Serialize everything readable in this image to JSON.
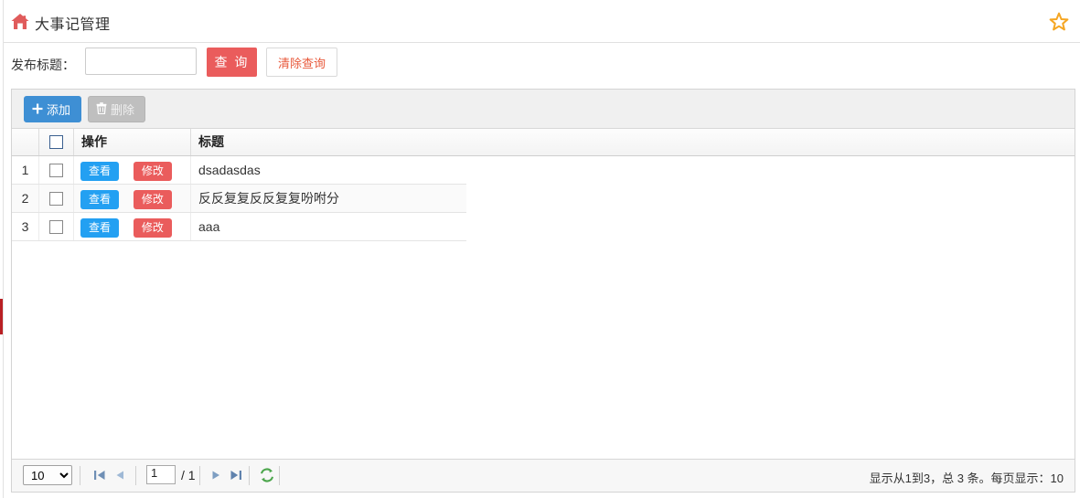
{
  "header": {
    "home_icon": "home-icon",
    "title": "大事记管理",
    "star_icon": "star-favorite-icon"
  },
  "search": {
    "label": "发布标题：",
    "input_value": "",
    "input_placeholder": "",
    "query_button": "查 询",
    "clear_button": "清除查询"
  },
  "toolbar": {
    "add_label": "添加",
    "add_icon": "plus-icon",
    "delete_label": "删除",
    "delete_icon": "trash-icon"
  },
  "grid": {
    "columns": [
      "",
      "",
      "操作",
      "标题"
    ],
    "header_checkbox": "select-all-checkbox",
    "row_actions": {
      "view": "查看",
      "edit": "修改"
    },
    "rows": [
      {
        "index": "1",
        "title": "dsadasdas"
      },
      {
        "index": "2",
        "title": "反反复复反反复复吩咐分"
      },
      {
        "index": "3",
        "title": "aaa"
      }
    ]
  },
  "pager": {
    "page_size": "10",
    "page_size_options": [
      "10"
    ],
    "first_icon": "first-page-icon",
    "prev_icon": "prev-page-icon",
    "page_number": "1",
    "page_total": "/ 1",
    "next_icon": "next-page-icon",
    "last_icon": "last-page-icon",
    "refresh_icon": "refresh-icon",
    "info": "显示从1到3，总 3 条。每页显示：10"
  },
  "colors": {
    "primary_blue": "#3e8fd4",
    "action_blue": "#23a0f2",
    "accent_red": "#ea5c5c",
    "clear_text": "#e8593b",
    "star_gold": "#f5a623",
    "sidebar_active": "#b92024",
    "refresh_green": "#4ca64c"
  }
}
